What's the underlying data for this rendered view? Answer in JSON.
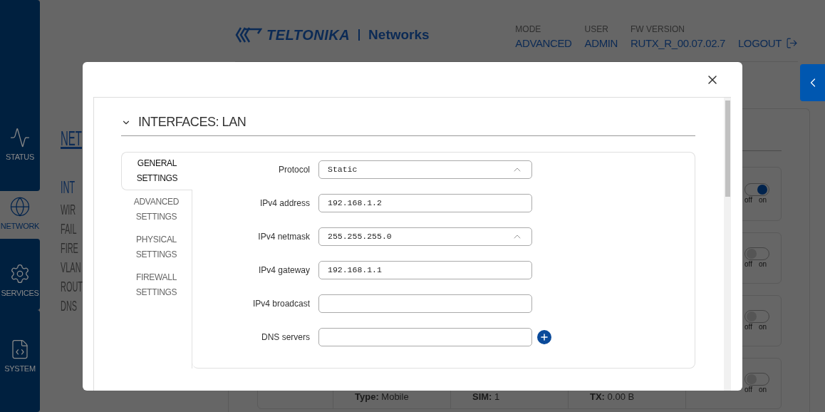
{
  "sidebar": {
    "items": [
      {
        "label": "STATUS",
        "selected": false
      },
      {
        "label": "NETWORK",
        "selected": true
      },
      {
        "label": "SERVICES",
        "selected": false
      },
      {
        "label": "SYSTEM",
        "selected": false
      }
    ]
  },
  "header": {
    "logo": {
      "brand": "TELTONIKA",
      "product": "Networks"
    },
    "info": [
      {
        "label": "MODE",
        "value": "ADVANCED"
      },
      {
        "label": "USER",
        "value": "ADMIN"
      },
      {
        "label": "FW VERSION",
        "value": "RUTX_R_00.07.02.7"
      }
    ],
    "logout": "LOGOUT"
  },
  "page": {
    "title": "NET",
    "menu": [
      {
        "label": "INT",
        "selected": true
      },
      {
        "label": "WIR",
        "selected": false
      },
      {
        "label": "FAIL",
        "selected": false
      },
      {
        "label": "FIRE",
        "selected": false
      },
      {
        "label": "VLAN",
        "selected": false
      },
      {
        "label": "ROUT",
        "selected": false
      },
      {
        "label": "DNS",
        "selected": false
      }
    ]
  },
  "background_rows": [
    {
      "on": true,
      "off_label": "off",
      "on_label": "on"
    },
    {
      "on": false,
      "off_label": "off",
      "on_label": "on"
    },
    {
      "on": false,
      "off_label": "off",
      "on_label": "on"
    },
    {
      "on": false,
      "off_label": "off",
      "on_label": "on",
      "details": [
        "**Type:** Mobile",
        "**SIM:** 1",
        "**TX:** 0.00 B"
      ]
    }
  ],
  "modal": {
    "section": {
      "title": "INTERFACES: LAN",
      "expanded": true
    },
    "tabs": [
      {
        "label": "GENERAL SETTINGS",
        "selected": true
      },
      {
        "label": "ADVANCED SETTINGS",
        "selected": false
      },
      {
        "label": "PHYSICAL SETTINGS",
        "selected": false
      },
      {
        "label": "FIREWALL SETTINGS",
        "selected": false
      }
    ],
    "fields": [
      {
        "label": "Protocol",
        "kind": "select",
        "value": "Static"
      },
      {
        "label": "IPv4 address",
        "kind": "input",
        "value": "192.168.1.2"
      },
      {
        "label": "IPv4 netmask",
        "kind": "select",
        "value": "255.255.255.0"
      },
      {
        "label": "IPv4 gateway",
        "kind": "input",
        "value": "192.168.1.1"
      },
      {
        "label": "IPv4 broadcast",
        "kind": "input"
      },
      {
        "label": "DNS servers",
        "kind": "list"
      }
    ]
  }
}
